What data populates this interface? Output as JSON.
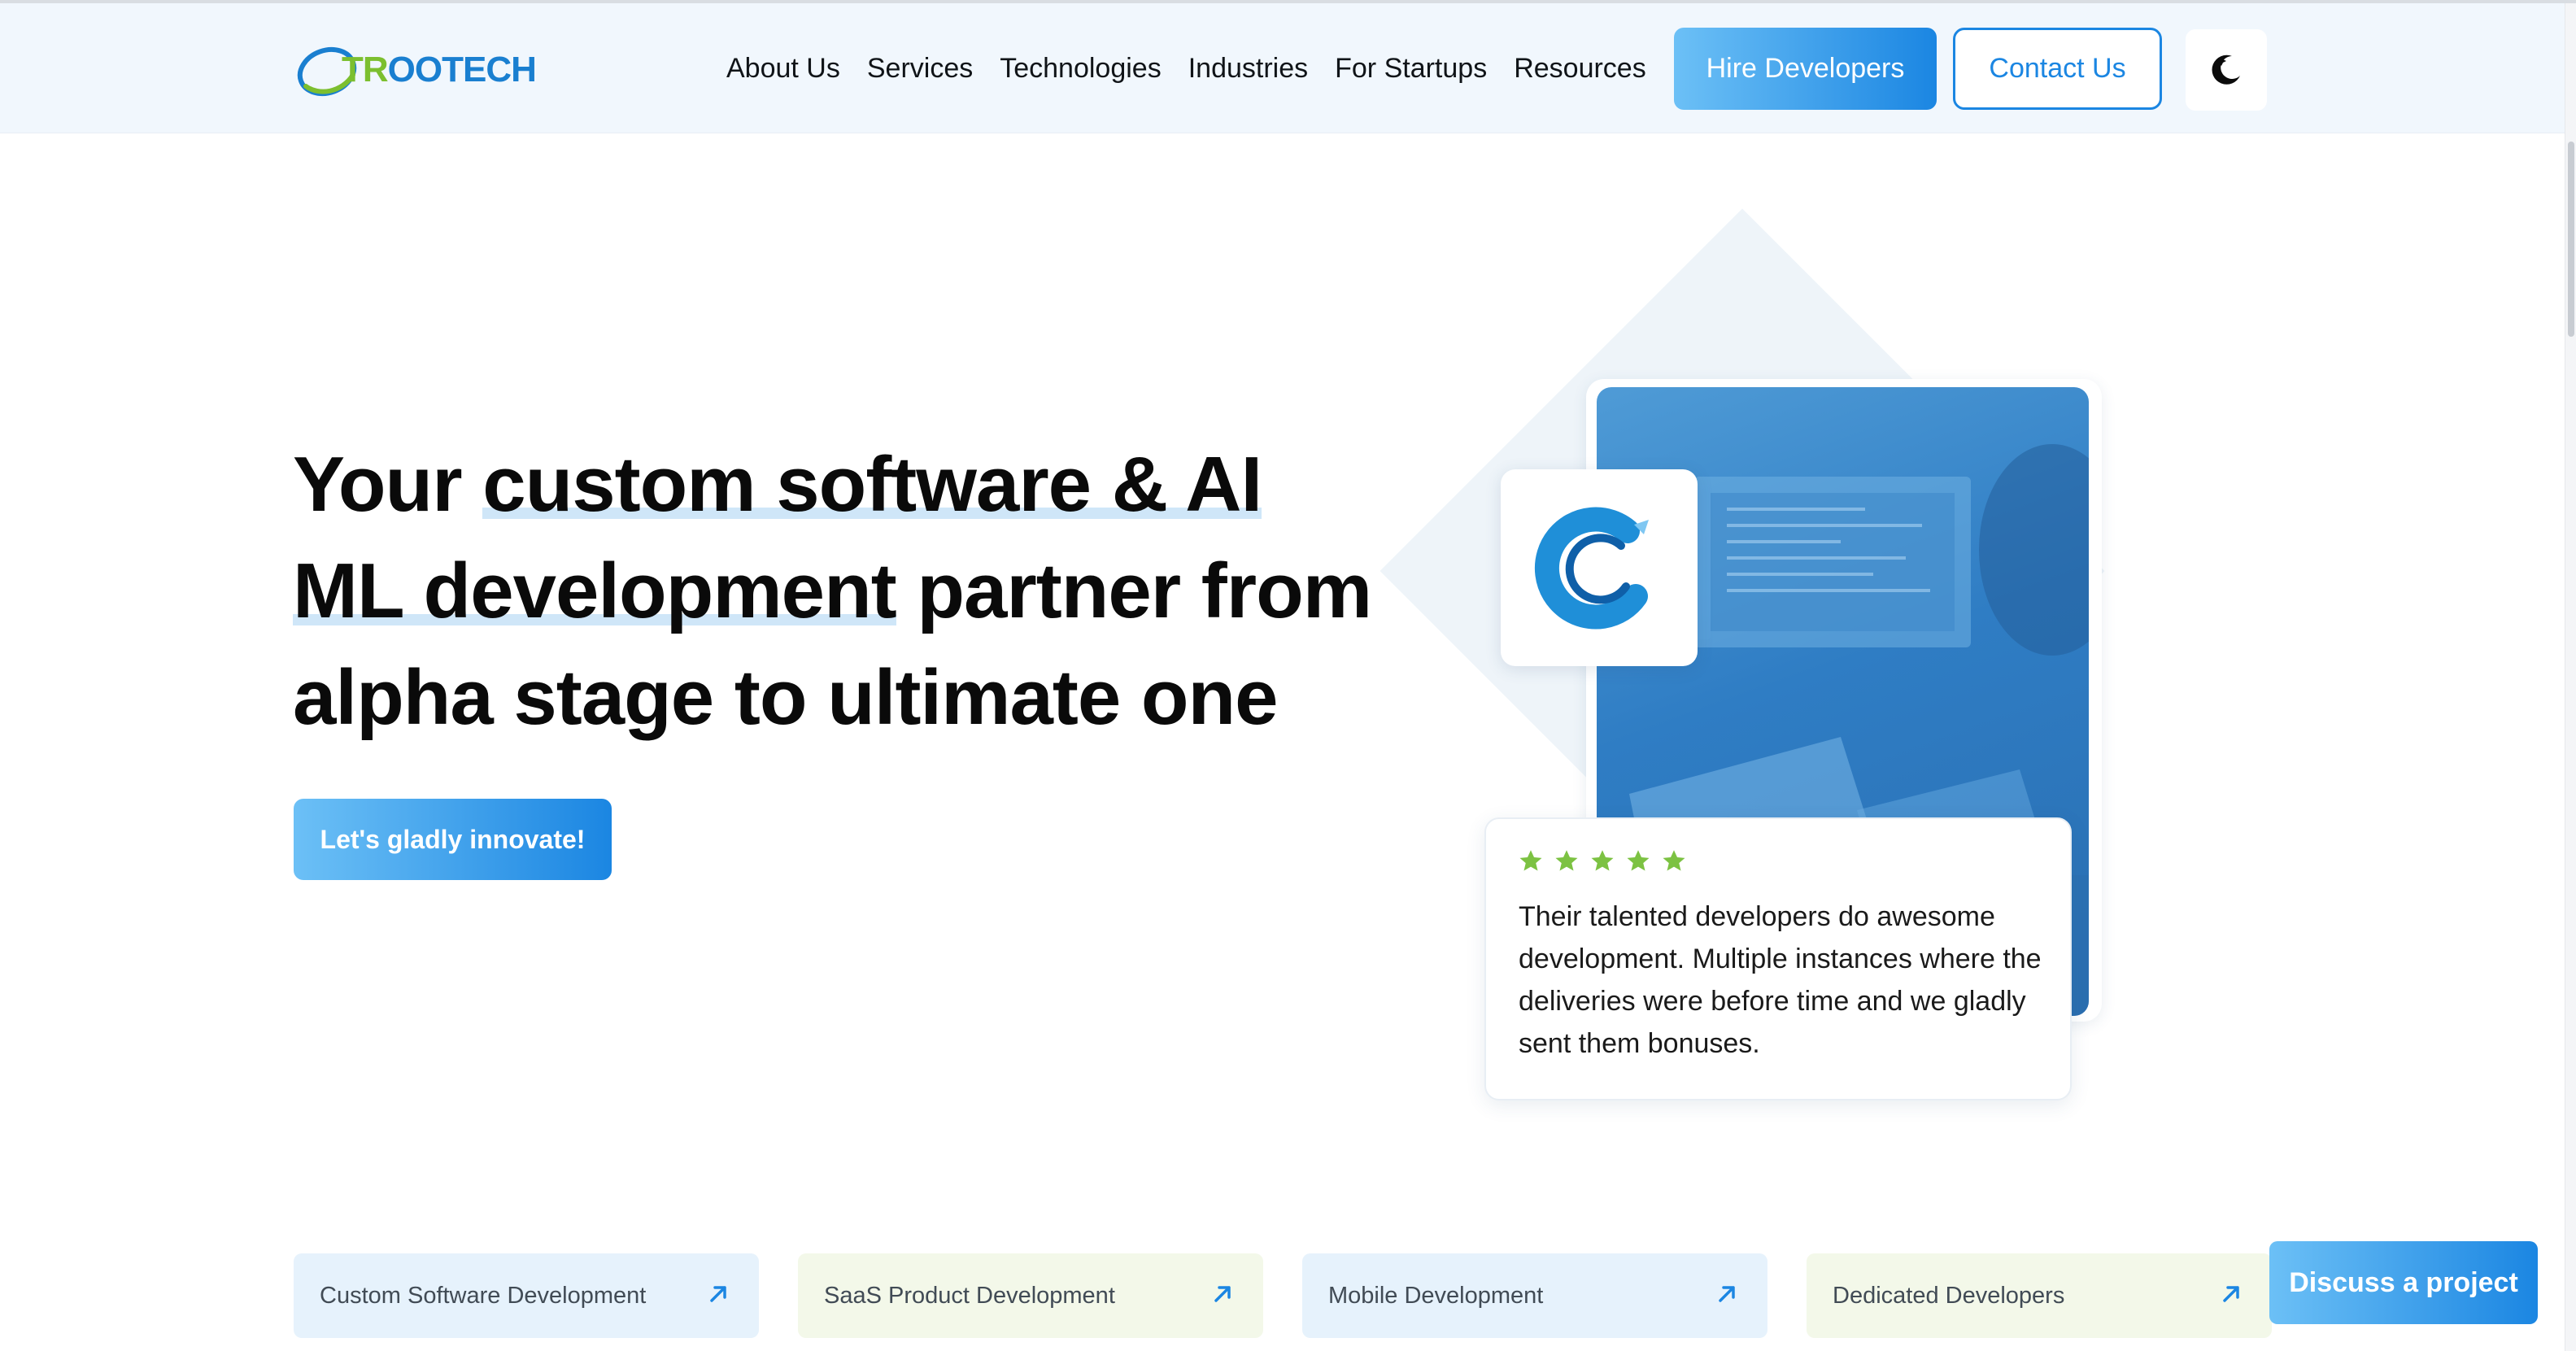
{
  "header": {
    "logo_text_green": "TR",
    "logo_text_blue": "OOTECH",
    "nav": [
      "About Us",
      "Services",
      "Technologies",
      "Industries",
      "For Startups",
      "Resources"
    ],
    "hire_label": "Hire Developers",
    "contact_label": "Contact Us",
    "theme_icon": "moon-icon"
  },
  "hero": {
    "title_line1_plain": "Your ",
    "title_line1_hl": "custom software & AI",
    "title_line2_hl": "ML development",
    "title_line2_plain": " partner from",
    "title_line3": "alpha stage to ultimate one",
    "cta_label": "Let's gladly innovate!"
  },
  "testimonial": {
    "rating": 5,
    "text": "Their talented developers do awesome development. Multiple instances where the deliveries were before time and we gladly sent them bonuses."
  },
  "services": [
    {
      "label": "Custom Software Development",
      "tone": "blue"
    },
    {
      "label": "SaaS Product Development",
      "tone": "green"
    },
    {
      "label": "Mobile Development",
      "tone": "blue"
    },
    {
      "label": "Dedicated Developers",
      "tone": "green"
    }
  ],
  "discuss_label": "Discuss a project",
  "colors": {
    "accent": "#1b86e2",
    "accent_light": "#6cc0f6",
    "star": "#7cc242",
    "header_bg": "#f1f7fd"
  }
}
